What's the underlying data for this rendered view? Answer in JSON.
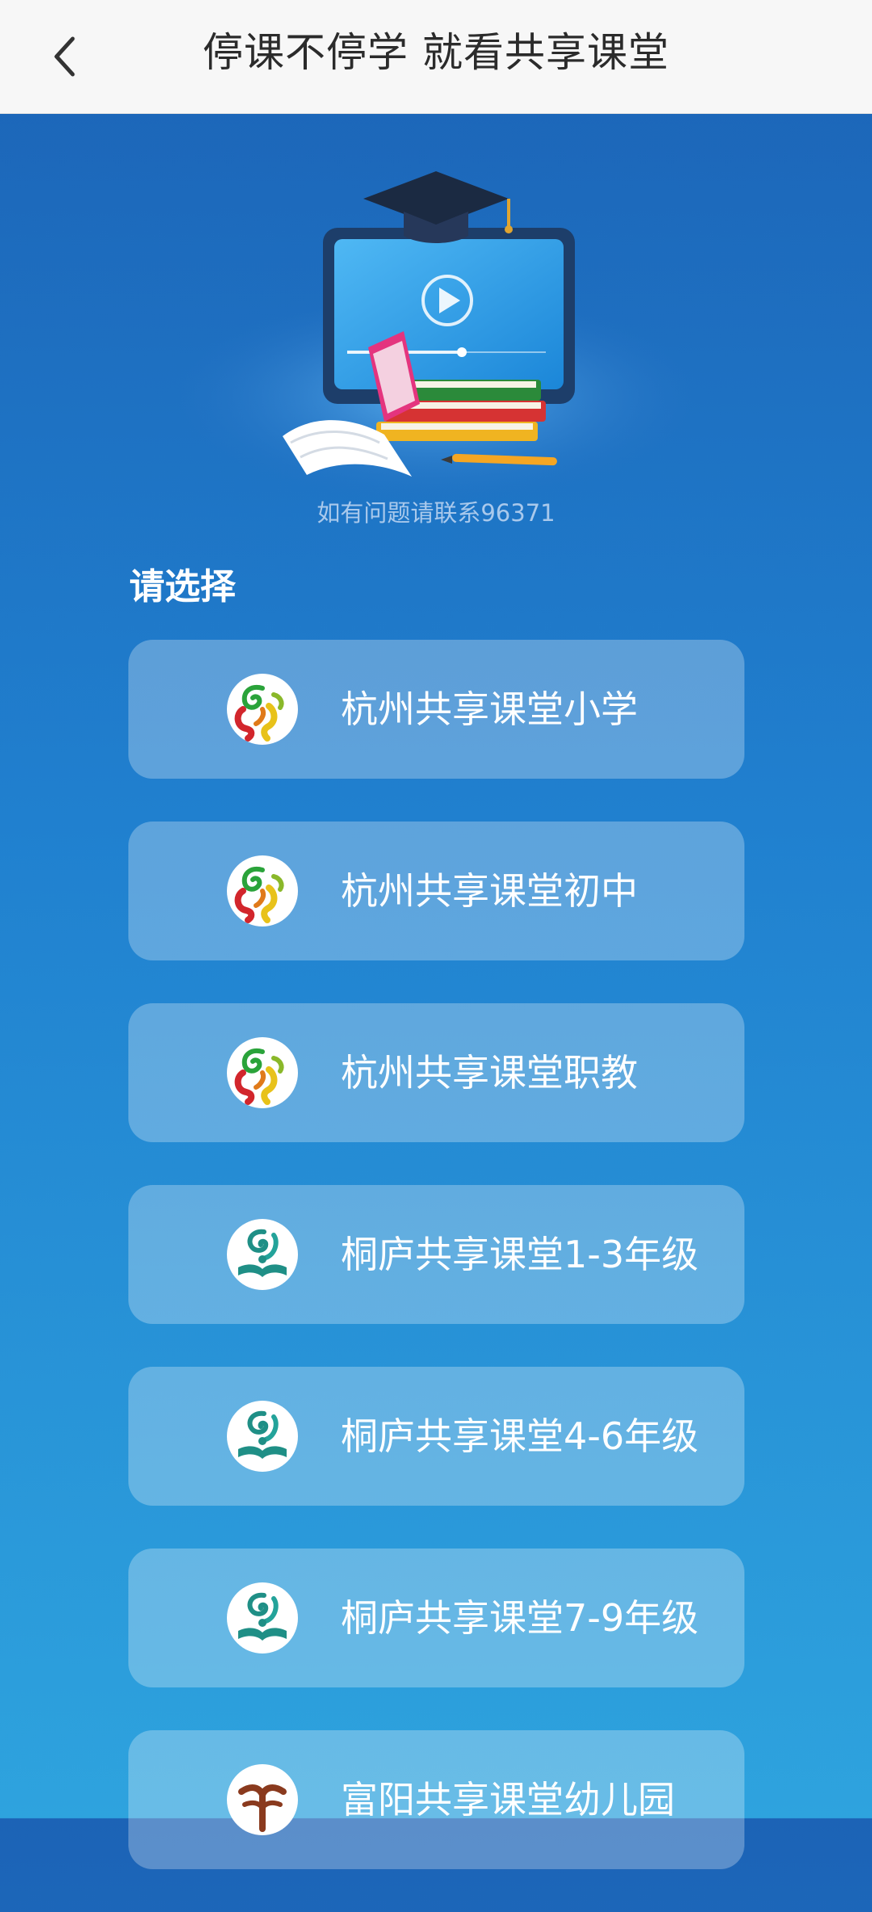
{
  "header": {
    "title": "停课不停学 就看共享课堂",
    "back_icon": "chevron-left-icon"
  },
  "hero": {
    "illustration": "tv-graduation-cap-books-illustration",
    "contact_text": "如有问题请联系96371"
  },
  "section": {
    "title": "请选择"
  },
  "options": [
    {
      "label": "杭州共享课堂小学",
      "icon": "hangzhou-education-logo-icon"
    },
    {
      "label": "杭州共享课堂初中",
      "icon": "hangzhou-education-logo-icon"
    },
    {
      "label": "杭州共享课堂职教",
      "icon": "hangzhou-education-logo-icon"
    },
    {
      "label": "桐庐共享课堂1-3年级",
      "icon": "tonglu-education-logo-icon"
    },
    {
      "label": "桐庐共享课堂4-6年级",
      "icon": "tonglu-education-logo-icon"
    },
    {
      "label": "桐庐共享课堂7-9年级",
      "icon": "tonglu-education-logo-icon"
    },
    {
      "label": "富阳共享课堂幼儿园",
      "icon": "fuyang-education-logo-icon"
    }
  ],
  "colors": {
    "background_top": "#1c63b6",
    "background_bottom": "#2ea3de",
    "header_bg": "#f7f7f7",
    "contact_text": "#a9c9ec",
    "option_text": "#ffffff"
  }
}
